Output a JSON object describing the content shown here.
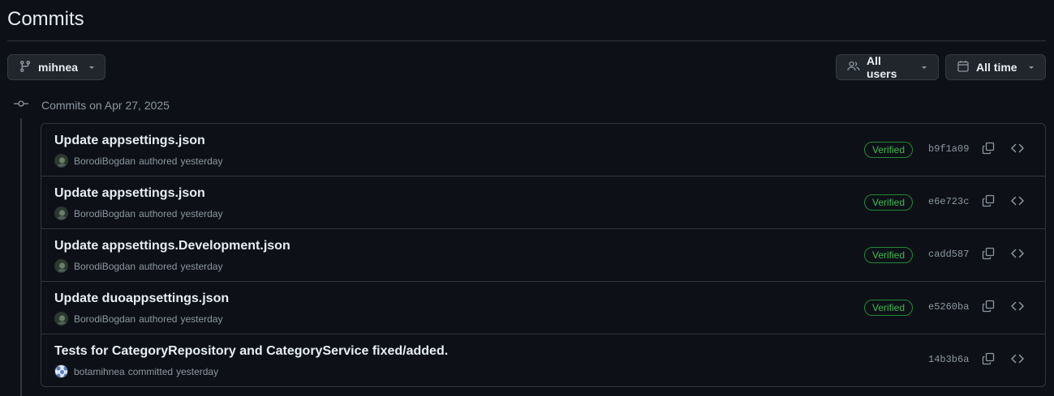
{
  "page": {
    "title": "Commits"
  },
  "filters": {
    "branch": "mihnea",
    "users": "All users",
    "time": "All time"
  },
  "group": {
    "label": "Commits on Apr 27, 2025"
  },
  "commits": [
    {
      "title": "Update appsettings.json",
      "author": "BorodiBogdan",
      "action": "authored",
      "when": "yesterday",
      "verified": "Verified",
      "sha": "b9f1a09"
    },
    {
      "title": "Update appsettings.json",
      "author": "BorodiBogdan",
      "action": "authored",
      "when": "yesterday",
      "verified": "Verified",
      "sha": "e6e723c"
    },
    {
      "title": "Update appsettings.Development.json",
      "author": "BorodiBogdan",
      "action": "authored",
      "when": "yesterday",
      "verified": "Verified",
      "sha": "cadd587"
    },
    {
      "title": "Update duoappsettings.json",
      "author": "BorodiBogdan",
      "action": "authored",
      "when": "yesterday",
      "verified": "Verified",
      "sha": "e5260ba"
    },
    {
      "title": "Tests for CategoryRepository and CategoryService fixed/added.",
      "author": "botamihnea",
      "action": "committed",
      "when": "yesterday",
      "verified": null,
      "sha": "14b3b6a"
    }
  ],
  "colors": {
    "background": "#0d1117",
    "border": "#30363d",
    "verified": "#3fb950",
    "muted": "#8d96a0"
  },
  "icons": {
    "branch": "git-branch-icon",
    "users": "people-icon",
    "time": "calendar-icon",
    "commit": "git-commit-icon",
    "copy": "copy-icon",
    "browse": "code-icon"
  }
}
